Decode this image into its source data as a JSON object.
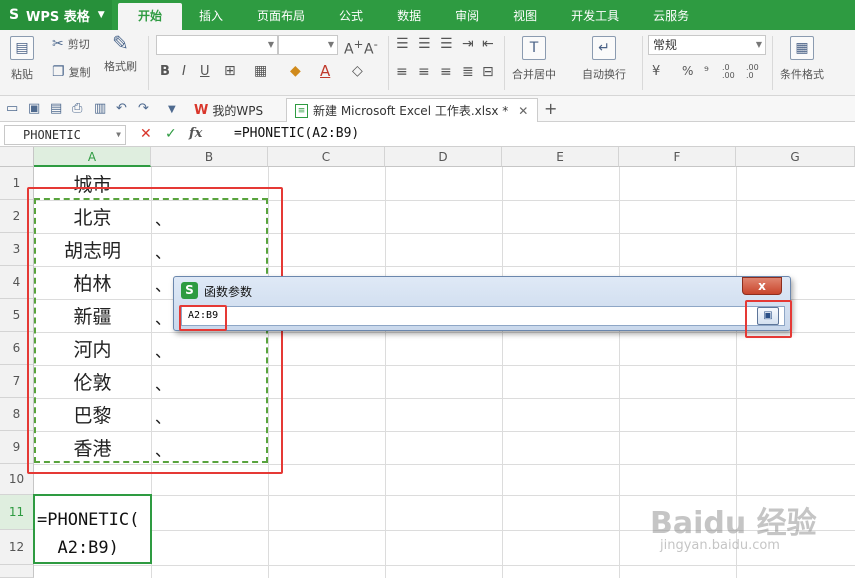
{
  "app": {
    "name": "WPS 表格"
  },
  "menu_tabs": [
    "开始",
    "插入",
    "页面布局",
    "公式",
    "数据",
    "审阅",
    "视图",
    "开发工具",
    "云服务"
  ],
  "ribbon": {
    "paste": "粘贴",
    "cut": "剪切",
    "copy": "复制",
    "format_painter": "格式刷",
    "merge_center": "合并居中",
    "wrap_text": "自动换行",
    "number_format": "常规",
    "conditional_format": "条件格式",
    "percent": "%",
    "comma": "⁹",
    "inc_decimal": ".0 .00",
    "dec_decimal": ".00 .0"
  },
  "doc_tabs": [
    {
      "label": "我的WPS"
    },
    {
      "label": "新建 Microsoft Excel 工作表.xlsx *"
    }
  ],
  "formula_bar": {
    "name_box": "PHONETIC",
    "formula": "=PHONETIC(A2:B9)"
  },
  "columns": [
    "A",
    "B",
    "C",
    "D",
    "E",
    "F",
    "G"
  ],
  "rows": [
    "1",
    "2",
    "3",
    "4",
    "5",
    "6",
    "7",
    "8",
    "9",
    "10",
    "11",
    "12"
  ],
  "cells": {
    "a1": "城市",
    "a2": "北京",
    "a3": "胡志明",
    "a4": "柏林",
    "a5": "新疆",
    "a6": "河内",
    "a7": "伦敦",
    "a8": "巴黎",
    "a9": "香港",
    "b_mark": "、",
    "a11_line1": "=PHONETIC(",
    "a11_line2": "  A2:B9)"
  },
  "dialog": {
    "title": "函数参数",
    "input_value": "A2:B9",
    "close": "x"
  },
  "watermark": {
    "brand": "Baidu 经验",
    "url": "jingyan.baidu.com"
  },
  "colors": {
    "accent": "#2e9b41",
    "annotation": "#e53935",
    "selection_dash": "#58a33d"
  }
}
